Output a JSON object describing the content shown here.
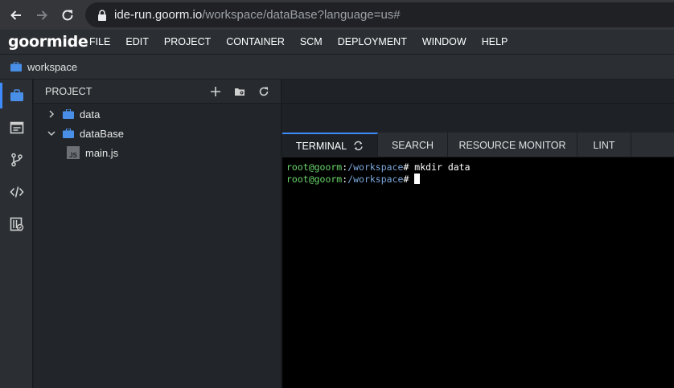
{
  "browser": {
    "url_host": "ide-run.goorm.io",
    "url_path": "/workspace/dataBase?language=us#"
  },
  "app": {
    "logo": "goormide",
    "menu": [
      "FILE",
      "EDIT",
      "PROJECT",
      "CONTAINER",
      "SCM",
      "DEPLOYMENT",
      "WINDOW",
      "HELP"
    ]
  },
  "workspace": {
    "label": "workspace"
  },
  "project": {
    "title": "PROJECT",
    "tree": [
      {
        "label": "data",
        "type": "folder",
        "expanded": false
      },
      {
        "label": "dataBase",
        "type": "folder",
        "expanded": true
      },
      {
        "label": "main.js",
        "type": "file",
        "badge": "JS"
      }
    ]
  },
  "panel": {
    "tabs": [
      "TERMINAL",
      "SEARCH",
      "RESOURCE MONITOR",
      "LINT"
    ],
    "active_tab": "TERMINAL"
  },
  "terminal": {
    "lines": [
      {
        "user": "root@goorm",
        "sep": ":",
        "path": "/workspace",
        "prompt": "# ",
        "command": "mkdir data"
      },
      {
        "user": "root@goorm",
        "sep": ":",
        "path": "/workspace",
        "prompt": "# ",
        "command": ""
      }
    ]
  },
  "colors": {
    "accent": "#3d8bfd",
    "folder": "#4a8fe7",
    "terminal_user": "#6bd66b",
    "terminal_path": "#7aa6da"
  }
}
